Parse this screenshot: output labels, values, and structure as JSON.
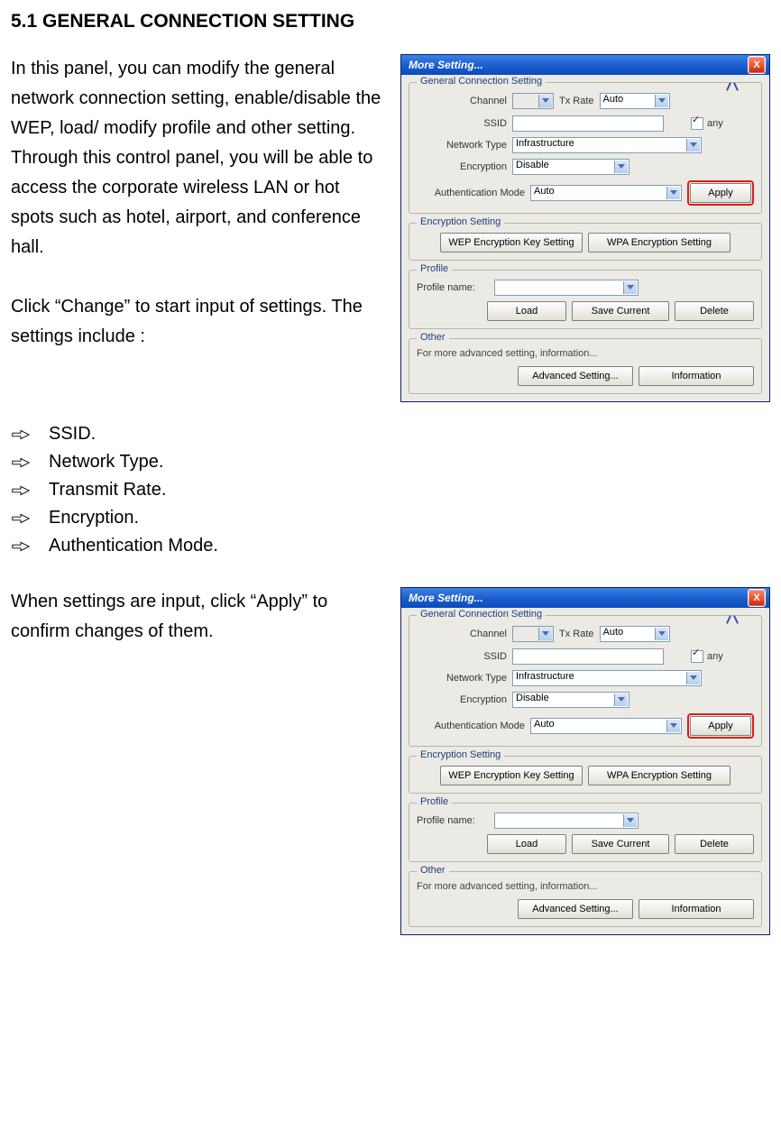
{
  "doc": {
    "heading": "5.1 GENERAL CONNECTION SETTING",
    "para1": "In this panel, you can modify the general network connection setting, enable/disable the WEP, load/ modify profile and other setting. Through this control panel, you will be able to access the corporate wireless LAN or hot spots such as hotel, airport, and conference hall.",
    "para2": "Click “Change” to start input of settings. The settings include :",
    "list": [
      "SSID.",
      "Network Type.",
      "Transmit Rate.",
      "Encryption.",
      "Authentication Mode."
    ],
    "para3": "When settings are input, click “Apply” to confirm changes of them."
  },
  "dialog": {
    "title": "More Setting...",
    "close": "X",
    "groups": {
      "general": {
        "legend": "General Connection Setting",
        "channel_label": "Channel",
        "channel_value": "",
        "txrate_label": "Tx Rate",
        "txrate_value": "Auto",
        "ssid_label": "SSID",
        "ssid_value": "",
        "any_label": "any",
        "network_type_label": "Network Type",
        "network_type_value": "Infrastructure",
        "encryption_label": "Encryption",
        "encryption_value": "Disable",
        "auth_label": "Authentication Mode",
        "auth_value": "Auto",
        "apply_label": "Apply"
      },
      "encset": {
        "legend": "Encryption Setting",
        "wep_button": "WEP Encryption Key Setting",
        "wpa_button": "WPA Encryption Setting"
      },
      "profile": {
        "legend": "Profile",
        "name_label": "Profile name:",
        "load": "Load",
        "save": "Save Current",
        "delete": "Delete"
      },
      "other": {
        "legend": "Other",
        "hint": "For more advanced setting, information...",
        "adv": "Advanced Setting...",
        "info": "Information"
      }
    }
  }
}
